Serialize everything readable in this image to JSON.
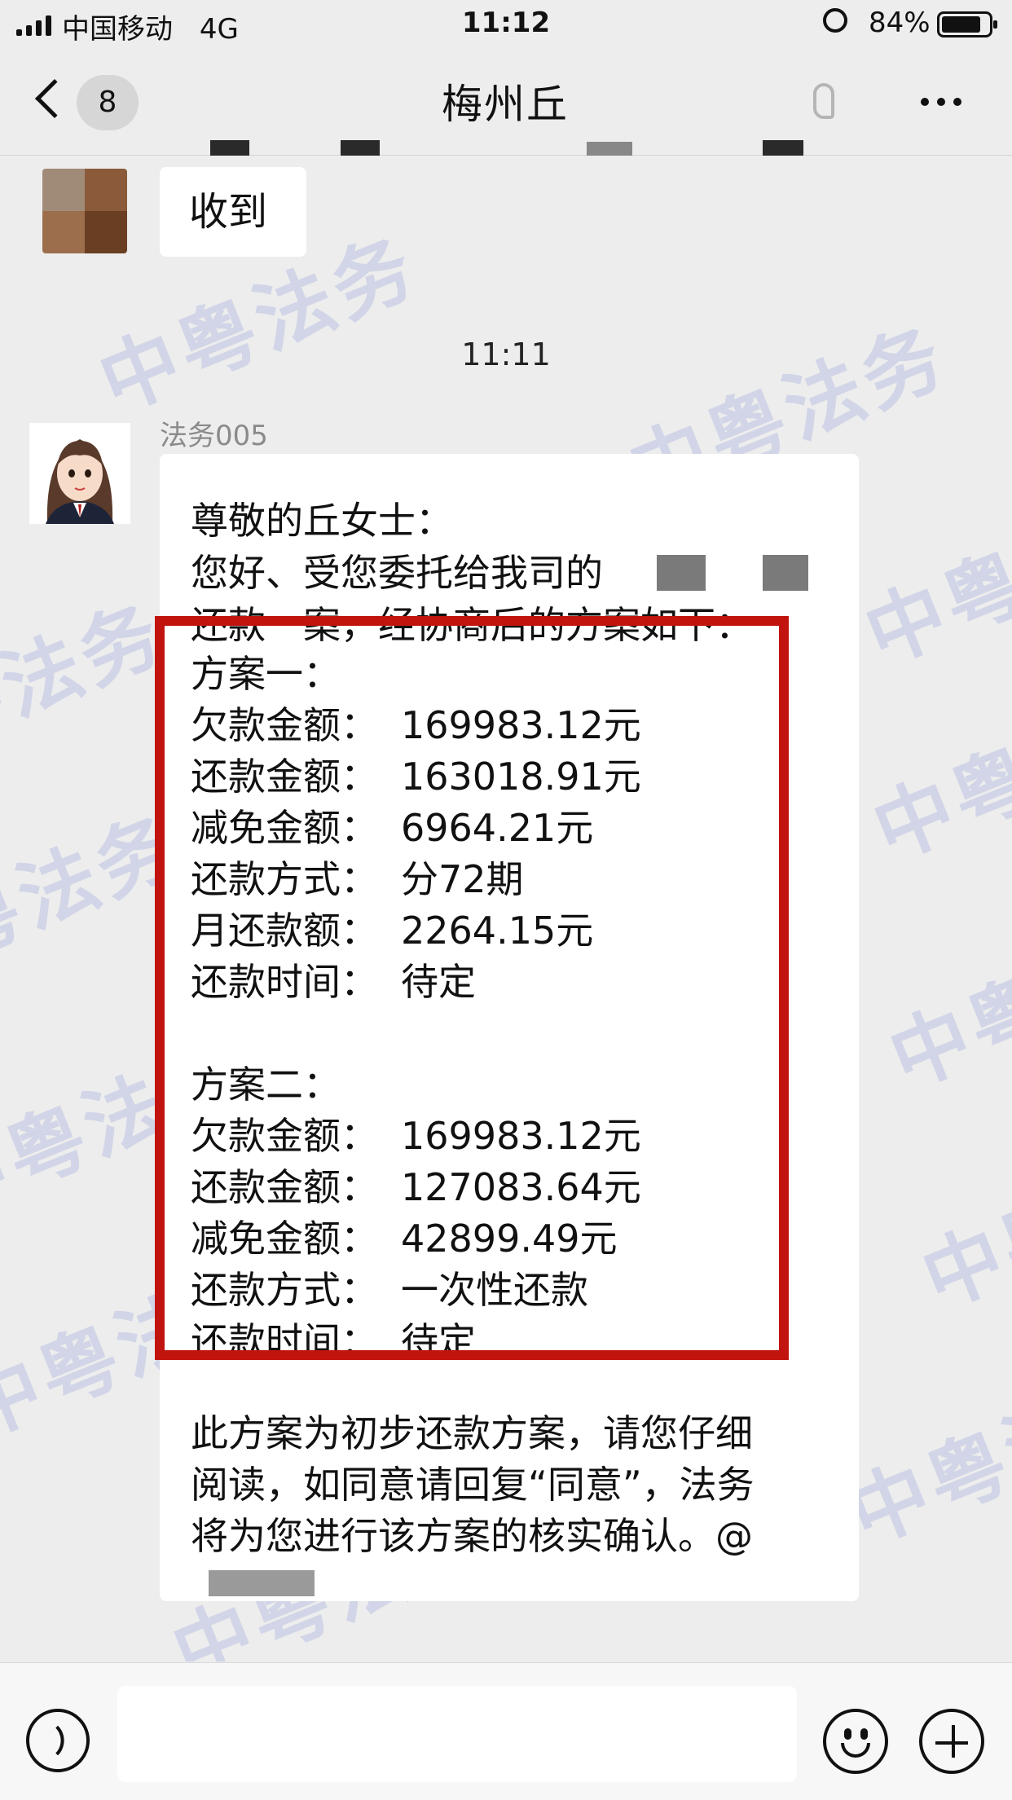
{
  "status_bar": {
    "carrier": "中国移动",
    "network": "4G",
    "time": "11:12",
    "battery": "84%",
    "battery_level": 0.84
  },
  "nav": {
    "unread_count": "8",
    "title_visible": "梅州丘",
    "back_icon": "chevron-left-icon",
    "more_icon": "ellipsis-icon"
  },
  "watermark": "中粤法务",
  "messages": [
    {
      "type": "text",
      "side": "left",
      "text": "收到"
    },
    {
      "type": "timestamp",
      "text": "11:11"
    },
    {
      "type": "text",
      "side": "left",
      "sender": "法务005",
      "intro": [
        "尊敬的丘女士：",
        "您好、受您委托给我司的",
        "还款一案，经协商后的方案如下："
      ],
      "plan1": {
        "title": "方案一：",
        "rows": [
          {
            "label": "欠款金额：",
            "value": "169983.12元"
          },
          {
            "label": "还款金额：",
            "value": "163018.91元"
          },
          {
            "label": "减免金额：",
            "value": "6964.21元"
          },
          {
            "label": "还款方式：",
            "value": "分72期"
          },
          {
            "label": "月还款额：",
            "value": "2264.15元"
          },
          {
            "label": "还款时间：",
            "value": "待定"
          }
        ]
      },
      "plan2": {
        "title": "方案二：",
        "rows": [
          {
            "label": "欠款金额：",
            "value": "169983.12元"
          },
          {
            "label": "还款金额：",
            "value": "127083.64元"
          },
          {
            "label": "减免金额：",
            "value": "42899.49元"
          },
          {
            "label": "还款方式：",
            "value": "一次性还款"
          },
          {
            "label": "还款时间：",
            "value": "待定"
          }
        ]
      },
      "closing": [
        "此方案为初步还款方案，请您仔细",
        "阅读，如同意请回复“同意”，法务",
        "将为您进行该方案的核实确认。@"
      ]
    }
  ],
  "input_bar": {
    "voice_icon": "voice-icon",
    "emoji_icon": "emoji-icon",
    "plus_icon": "plus-icon"
  },
  "colors": {
    "highlight_border": "#c2140f",
    "watermark": "#c8cee6",
    "background": "#ededed"
  }
}
